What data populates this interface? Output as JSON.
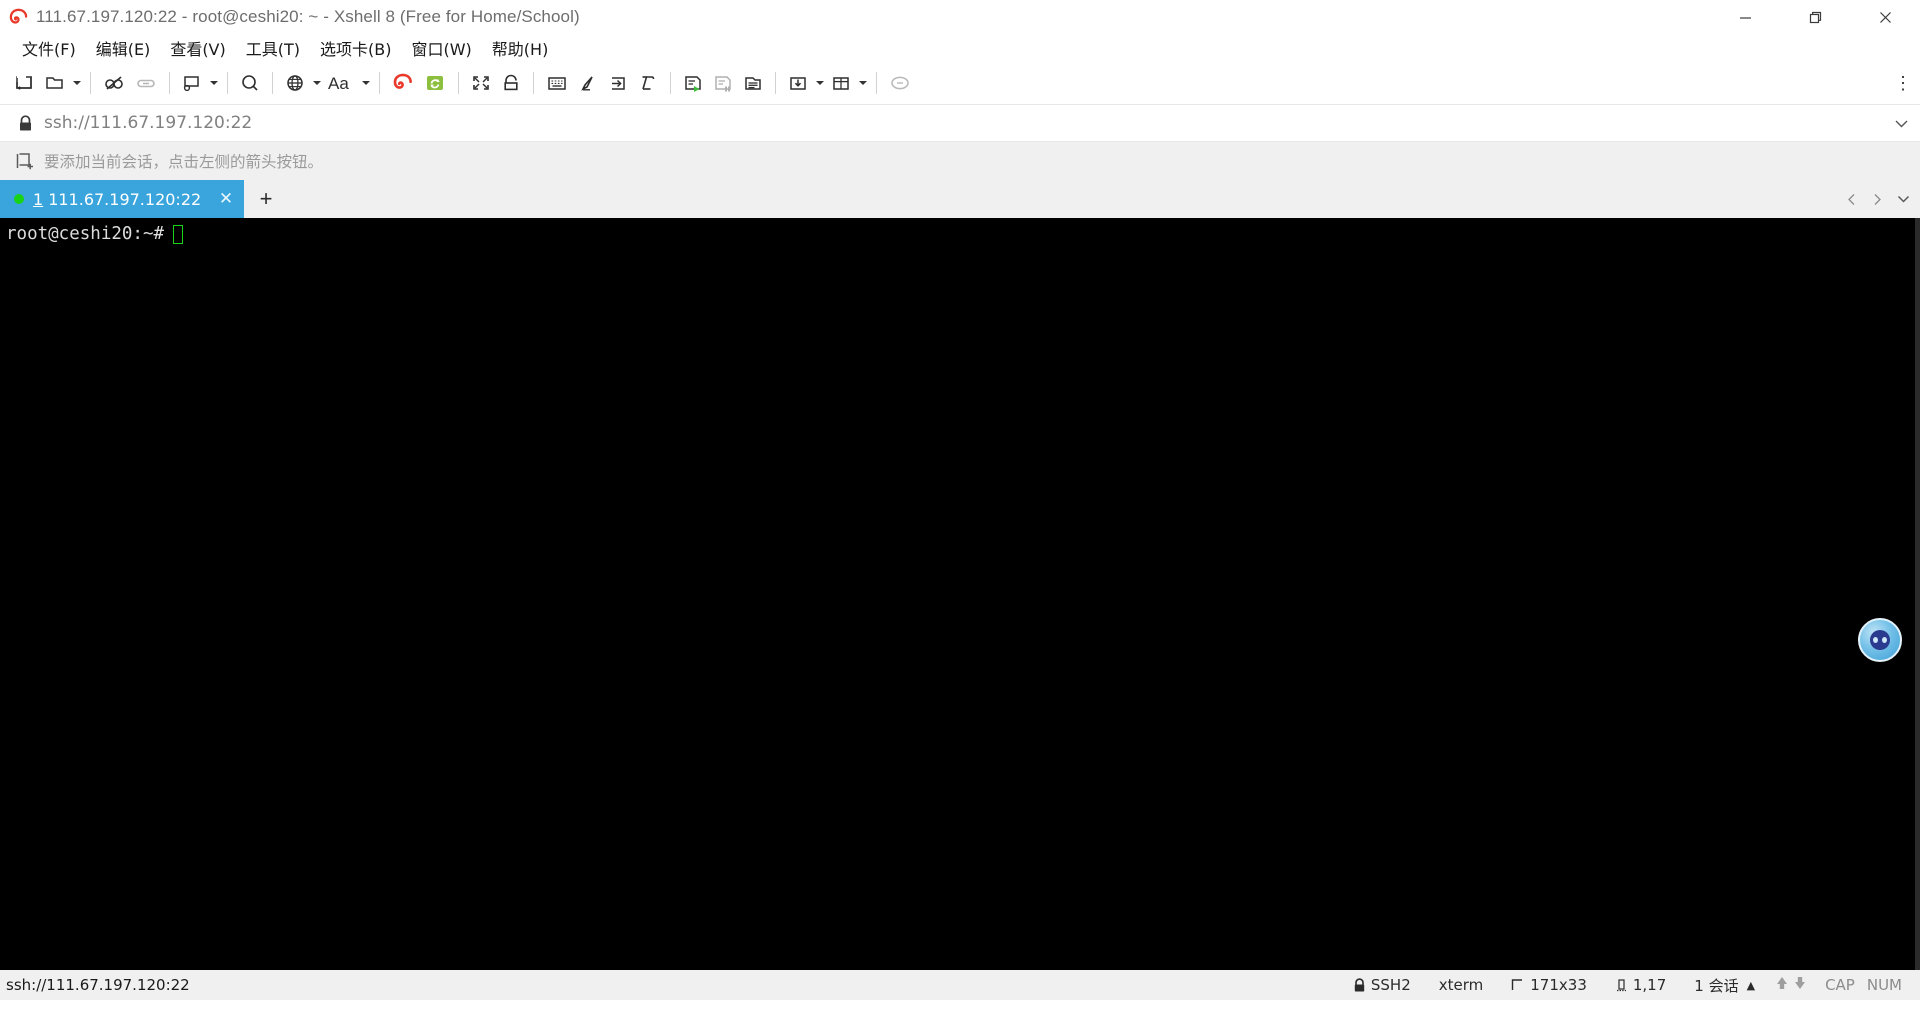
{
  "window": {
    "title": "111.67.197.120:22 - root@ceshi20: ~ - Xshell 8 (Free for Home/School)",
    "app_icon": "xshell-logo-icon",
    "controls": {
      "minimize": "minimize-icon",
      "restore": "restore-icon",
      "close": "close-icon"
    }
  },
  "menubar": {
    "items": [
      {
        "label": "文件(F)",
        "name": "menu-file"
      },
      {
        "label": "编辑(E)",
        "name": "menu-edit"
      },
      {
        "label": "查看(V)",
        "name": "menu-view"
      },
      {
        "label": "工具(T)",
        "name": "menu-tools"
      },
      {
        "label": "选项卡(B)",
        "name": "menu-tabs"
      },
      {
        "label": "窗口(W)",
        "name": "menu-window"
      },
      {
        "label": "帮助(H)",
        "name": "menu-help"
      }
    ]
  },
  "toolbar": {
    "overflow_label": "⋮",
    "buttons": [
      {
        "name": "new-session-icon",
        "has_caret": false
      },
      {
        "name": "open-session-folder-icon",
        "has_caret": true
      },
      {
        "name": "disconnect-icon",
        "has_caret": false
      },
      {
        "name": "reconnect-link-icon",
        "has_caret": false
      },
      {
        "name": "session-properties-icon",
        "has_caret": true
      },
      {
        "name": "find-icon",
        "has_caret": false
      },
      {
        "name": "encoding-globe-icon",
        "has_caret": true
      },
      {
        "name": "font-size-icon",
        "has_caret": true
      },
      {
        "name": "xftp-icon",
        "has_caret": false
      },
      {
        "name": "xftp-transfer-icon",
        "has_caret": false
      },
      {
        "name": "fullscreen-icon",
        "has_caret": false
      },
      {
        "name": "lock-screen-icon",
        "has_caret": false
      },
      {
        "name": "keyboard-compose-icon",
        "has_caret": false
      },
      {
        "name": "highlight-icon",
        "has_caret": false
      },
      {
        "name": "send-key-icon",
        "has_caret": false
      },
      {
        "name": "quick-command-icon",
        "has_caret": false
      },
      {
        "name": "log-start-icon",
        "has_caret": false
      },
      {
        "name": "log-pause-icon",
        "has_caret": false
      },
      {
        "name": "log-view-icon",
        "has_caret": false
      },
      {
        "name": "transfer-file-icon",
        "has_caret": true
      },
      {
        "name": "arrange-layout-icon",
        "has_caret": true
      },
      {
        "name": "chat-balloon-icon",
        "has_caret": false
      }
    ]
  },
  "address_bar": {
    "lock_icon": "lock-icon",
    "value": "ssh://111.67.197.120:22",
    "placeholder": "ssh://",
    "dropdown_icon": "chevron-down-icon"
  },
  "notice_bar": {
    "icon": "add-session-icon",
    "text": "要添加当前会话，点击左侧的箭头按钮。"
  },
  "tabs": {
    "items": [
      {
        "index": "1",
        "title": "111.67.197.120:22",
        "status": "connected",
        "close_label": "✕"
      }
    ],
    "new_tab_label": "+",
    "nav_prev_icon": "chevron-left-icon",
    "nav_next_icon": "chevron-right-icon",
    "nav_list_icon": "chevron-down-icon"
  },
  "terminal": {
    "prompt": "root@ceshi20:~#",
    "cursor": "block-cursor",
    "background": "#000000",
    "foreground": "#dcdcdc",
    "cursor_color": "#17d417"
  },
  "float_widget": {
    "name": "assistant-bubble-icon"
  },
  "status_bar": {
    "connection": "ssh://111.67.197.120:22",
    "protocol": "SSH2",
    "protocol_icon": "lock-icon",
    "terminal_type": "xterm",
    "size_icon": "screen-size-icon",
    "size": "171x33",
    "cursor_icon": "cursor-position-icon",
    "cursor_position": "1,17",
    "sessions": "1 会话",
    "sessions_caret": "▲",
    "upload_icon": "arrow-up-icon",
    "download_icon": "arrow-down-icon",
    "caps": "CAP",
    "num": "NUM"
  },
  "colors": {
    "accent": "#39a5dc",
    "tab_active": "#39a5dc",
    "connected_dot": "#18d318",
    "chrome": "#f0f0f0",
    "terminal_bg": "#000000"
  }
}
